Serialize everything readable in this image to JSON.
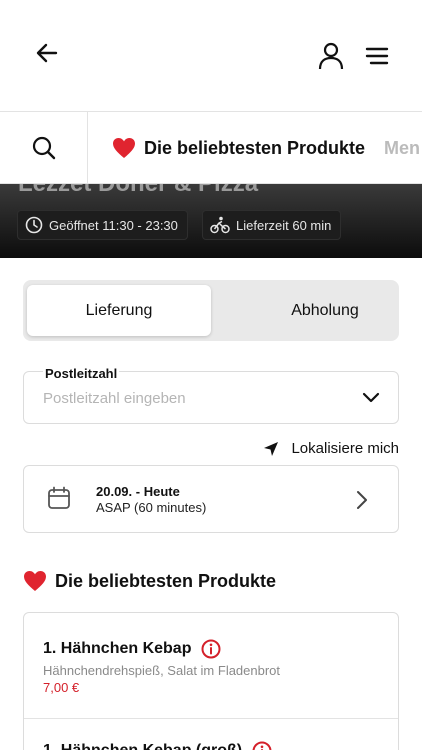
{
  "header": {
    "back_icon": "arrow-left-icon",
    "user_icon": "user-icon",
    "menu_icon": "hamburger-menu-icon"
  },
  "categories": {
    "search_icon": "search-icon",
    "items": [
      {
        "label": "Die beliebtesten Produkte",
        "icon": "heart-icon",
        "active": true
      },
      {
        "label": "Men",
        "active": false
      }
    ]
  },
  "hero": {
    "restaurant_name": "Lezzet Döner & Pizza",
    "opening_hours": "Geöffnet 11:30 - 23:30",
    "delivery_time": "Lieferzeit 60 min"
  },
  "order_type": {
    "options": [
      "Lieferung",
      "Abholung"
    ],
    "selected": "Lieferung"
  },
  "postal_code": {
    "label": "Postleitzahl",
    "placeholder": "Postleitzahl eingeben",
    "value": ""
  },
  "locate": {
    "label": "Lokalisiere mich"
  },
  "schedule": {
    "date": "20.09. - Heute",
    "time": "ASAP (60 minutes)"
  },
  "popular": {
    "title": "Die beliebtesten Produkte",
    "products": [
      {
        "name": "1. Hähnchen Kebap",
        "description": "Hähnchendrehspieß, Salat im Fladenbrot",
        "price": "7,00 €"
      },
      {
        "name": "1. Hähnchen Kebap (groß)",
        "description": "",
        "price": ""
      }
    ]
  },
  "colors": {
    "accent_red": "#d4202a",
    "hero_bg": "#1a1a1a",
    "border": "#dcdcdc"
  }
}
